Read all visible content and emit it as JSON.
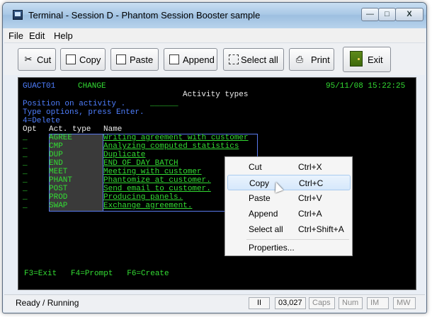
{
  "window": {
    "title": "Terminal - Session D - Phantom Session Booster sample",
    "min_glyph": "—",
    "max_glyph": "□",
    "close_glyph": "X"
  },
  "menu": {
    "file": "File",
    "edit": "Edit",
    "help": "Help"
  },
  "toolbar": {
    "cut": "Cut",
    "copy": "Copy",
    "paste": "Paste",
    "append": "Append",
    "select_all": "Select all",
    "print": "Print",
    "exit": "Exit",
    "cut_glyph": "✂",
    "print_glyph": "⎙"
  },
  "terminal": {
    "program": "GUACT01",
    "mode": "CHANGE",
    "datetime": "95/11/08 15:22:25",
    "heading": "Activity types",
    "position_prompt": "Position on activity .",
    "options_prompt": "Type options, press Enter.",
    "option_delete": "4=Delete",
    "col_opt": "Opt",
    "col_type": "Act. type",
    "col_name": "Name",
    "rows": [
      {
        "opt": "_",
        "code": "AGREE",
        "name": "Writing agreement with customer"
      },
      {
        "opt": "_",
        "code": "CMP",
        "name": "Analyzing computed statistics"
      },
      {
        "opt": "_",
        "code": "DUP",
        "name": "Duplicate"
      },
      {
        "opt": "_",
        "code": "END",
        "name": "END OF DAY BATCH"
      },
      {
        "opt": "_",
        "code": "MEET",
        "name": "Meeting with customer"
      },
      {
        "opt": "_",
        "code": "PHANT",
        "name": "Phantomize at customer."
      },
      {
        "opt": "_",
        "code": "POST",
        "name": "Send email to customer."
      },
      {
        "opt": "_",
        "code": "PROD",
        "name": "Producing panels."
      },
      {
        "opt": "_",
        "code": "SWAP",
        "name": "Exchange agreement."
      }
    ],
    "fkeys": "F3=Exit   F4=Prompt   F6=Create"
  },
  "context_menu": {
    "items": [
      {
        "label": "Cut",
        "shortcut": "Ctrl+X"
      },
      {
        "label": "Copy",
        "shortcut": "Ctrl+C"
      },
      {
        "label": "Paste",
        "shortcut": "Ctrl+V"
      },
      {
        "label": "Append",
        "shortcut": "Ctrl+A"
      },
      {
        "label": "Select all",
        "shortcut": "Ctrl+Shift+A"
      },
      {
        "label": "Properties...",
        "shortcut": ""
      }
    ]
  },
  "statusbar": {
    "status": "Ready / Running",
    "pause": "II",
    "cursor_pos": "03,027",
    "caps": "Caps",
    "num": "Num",
    "im": "IM",
    "mw": "MW"
  },
  "colors": {
    "terminal_bg": "#000000",
    "field_green": "#33dd33",
    "label_blue": "#4f7fff",
    "accent": "#a9cbef"
  }
}
